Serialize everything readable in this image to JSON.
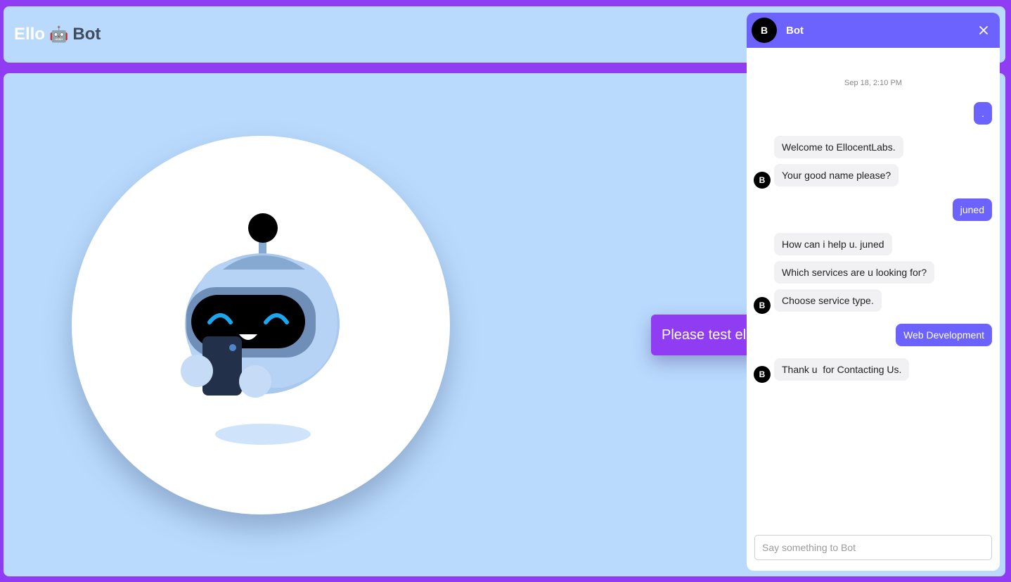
{
  "header": {
    "brand_part1": "Ello",
    "brand_emoji": "🤖",
    "brand_part2": "Bot"
  },
  "hero": {
    "cta_label": "Please test el"
  },
  "chat": {
    "title": "Bot",
    "avatar_letter": "B",
    "timestamp": "Sep 18, 2:10 PM",
    "messages": [
      {
        "from": "user",
        "text": "."
      },
      {
        "from": "bot",
        "text": "Welcome to EllocentLabs."
      },
      {
        "from": "bot",
        "text": "Your good name please?"
      },
      {
        "from": "user",
        "text": "juned"
      },
      {
        "from": "bot",
        "text": "How can i help u. juned"
      },
      {
        "from": "bot",
        "text": "Which services are u looking for?"
      },
      {
        "from": "bot",
        "text": "Choose service type."
      },
      {
        "from": "user",
        "text": "Web Development"
      },
      {
        "from": "bot",
        "text": "Thank u  for Contacting Us."
      }
    ],
    "input_placeholder": "Say something to Bot",
    "input_value": ""
  },
  "colors": {
    "frame": "#8f3cf2",
    "panel": "#b9dafd",
    "accent": "#6c63ff"
  },
  "icons": {
    "close": "close-icon",
    "robot": "robot-illustration"
  }
}
